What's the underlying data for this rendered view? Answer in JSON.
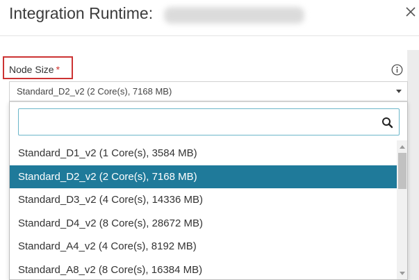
{
  "dialog": {
    "title": "Integration Runtime:",
    "close_icon": "close-icon"
  },
  "field": {
    "label": "Node Size",
    "required_mark": "*",
    "info_icon": "info-icon",
    "selected_value": "Standard_D2_v2 (2 Core(s), 7168 MB)"
  },
  "dropdown": {
    "search_value": "",
    "search_icon": "search-icon",
    "options": [
      {
        "label": "Standard_D1_v2 (1 Core(s), 3584 MB)",
        "selected": false
      },
      {
        "label": "Standard_D2_v2 (2 Core(s), 7168 MB)",
        "selected": true
      },
      {
        "label": "Standard_D3_v2 (4 Core(s), 14336 MB)",
        "selected": false
      },
      {
        "label": "Standard_D4_v2 (8 Core(s), 28672 MB)",
        "selected": false
      },
      {
        "label": "Standard_A4_v2 (4 Core(s), 8192 MB)",
        "selected": false
      },
      {
        "label": "Standard_A8_v2 (8 Core(s), 16384 MB)",
        "selected": false
      }
    ]
  },
  "colors": {
    "accent": "#1f7a9a",
    "required": "#d0312d",
    "highlight_border": "#cc3333",
    "search_border": "#6bb6c9"
  }
}
